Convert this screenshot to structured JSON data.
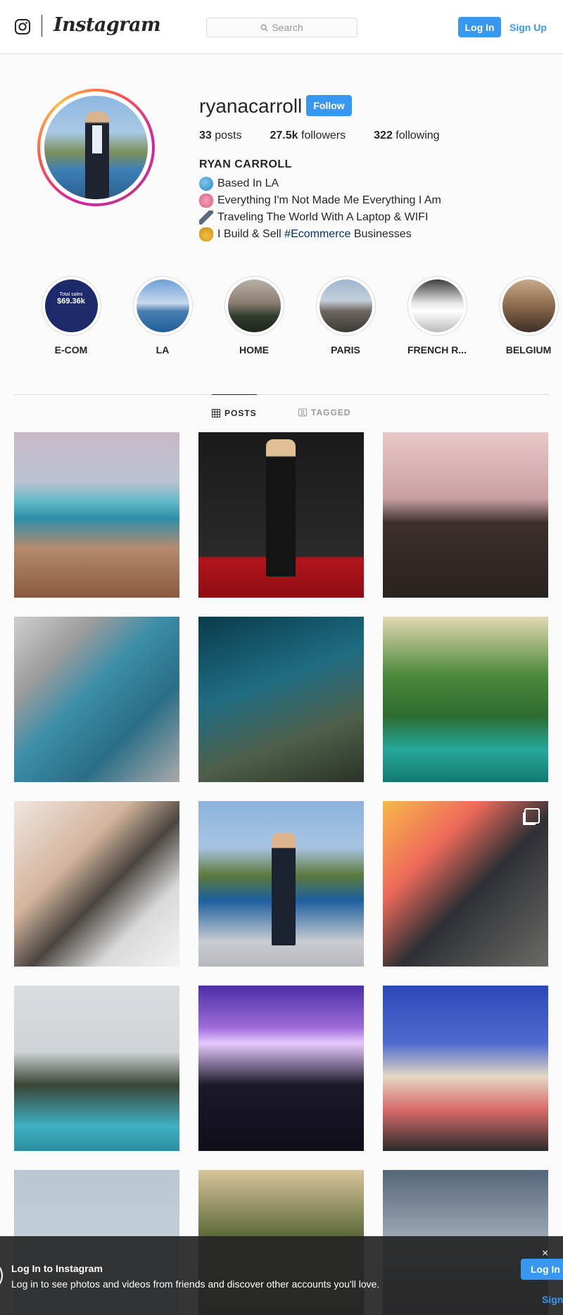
{
  "header": {
    "wordmark": "Instagram",
    "search_placeholder": "Search",
    "login_label": "Log In",
    "signup_label": "Sign Up"
  },
  "profile": {
    "username": "ryanacarroll",
    "follow_label": "Follow",
    "stats": {
      "posts_count": "33",
      "posts_label": "posts",
      "followers_count": "27.5k",
      "followers_label": "followers",
      "following_count": "322",
      "following_label": "following"
    },
    "full_name": "RYAN CARROLL",
    "bio": [
      {
        "icon": "globe-icon",
        "text": "Based In LA"
      },
      {
        "icon": "brain-icon",
        "text": "Everything I'm Not Made Me Everything I Am"
      },
      {
        "icon": "runner-icon",
        "text": "Traveling The World With A Laptop & WIFI"
      },
      {
        "icon": "money-bag-icon",
        "text_before": "I Build & Sell",
        "hashtag": "#Ecommerce",
        "text_after": "Businesses"
      }
    ]
  },
  "highlights": [
    {
      "label": "E-COM",
      "inner_title": "Total sales",
      "inner_value": "$69.36k"
    },
    {
      "label": "LA"
    },
    {
      "label": "HOME"
    },
    {
      "label": "PARIS"
    },
    {
      "label": "FRENCH R..."
    },
    {
      "label": "BELGIUM"
    }
  ],
  "tabs": {
    "posts_label": "POSTS",
    "tagged_label": "TAGGED"
  },
  "posts_grid": {
    "columns": 3,
    "visible_posts": 15,
    "multi_image_post_index": 9
  },
  "banner": {
    "title": "Log In to Instagram",
    "subtitle": "Log in to see photos and videos from friends and discover other accounts you'll love.",
    "login_label": "Log In",
    "signup_label": "Sign Up",
    "close_symbol": "×"
  },
  "colors": {
    "primary_blue": "#3897f0",
    "text": "#262626",
    "border": "#dbdbdb",
    "hashtag": "#003569"
  }
}
